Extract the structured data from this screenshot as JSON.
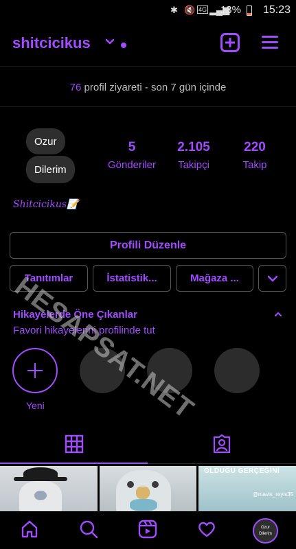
{
  "status_bar": {
    "battery": "13%",
    "time": "15:23"
  },
  "header": {
    "username": "shitcicikus"
  },
  "insights": {
    "count": "76",
    "text": "profil ziyareti - son 7 gün içinde"
  },
  "avatar": {
    "line1": "Ozur",
    "line2": "Dilerim"
  },
  "stats": [
    {
      "value": "5",
      "label": "Gönderiler"
    },
    {
      "value": "2.105",
      "label": "Takipçi"
    },
    {
      "value": "220",
      "label": "Takip"
    }
  ],
  "bio": "Shitcicikus📝",
  "buttons": {
    "edit_profile": "Profili Düzenle",
    "tab1": "Tanıtımlar",
    "tab2": "İstatistik...",
    "tab3": "Mağaza ..."
  },
  "highlights": {
    "title": "Hikayelerde Öne Çıkanlar",
    "subtitle": "Favori hikayelerini profilinde tut",
    "new_label": "Yeni"
  },
  "posts": {
    "thumb3_text": "OLDUĞU GERÇEĞİNİ",
    "thumb3_credit": "@mavis_reyis35"
  },
  "watermark": "HESAPSAT.NET",
  "colors": {
    "accent": "#a24cff",
    "background": "#000000"
  }
}
